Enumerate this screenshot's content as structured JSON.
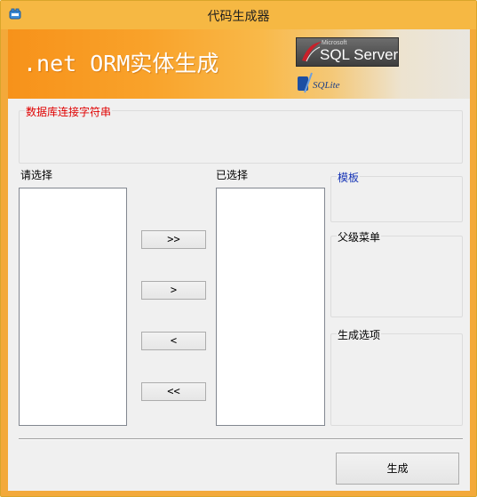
{
  "window": {
    "title": "代码生成器",
    "accent": "#f6b843"
  },
  "banner": {
    "title": ".net ORM实体生成",
    "sqlserver_logo_small": "Microsoft",
    "sqlserver_logo_text": "SQL Server",
    "sqlite_logo_text": "SQLite"
  },
  "connection": {
    "label": "数据库连接字符串",
    "label_color": "#e00000"
  },
  "available": {
    "label": "请选择"
  },
  "selected": {
    "label": "已选择"
  },
  "buttons": {
    "add_all": ">>",
    "add_one": ">",
    "remove_one": "<",
    "remove_all": "<<",
    "generate": "生成"
  },
  "template": {
    "label": "模板",
    "label_color": "#1533b5"
  },
  "parent_menu": {
    "label": "父级菜单"
  },
  "gen_options": {
    "label": "生成选项"
  }
}
